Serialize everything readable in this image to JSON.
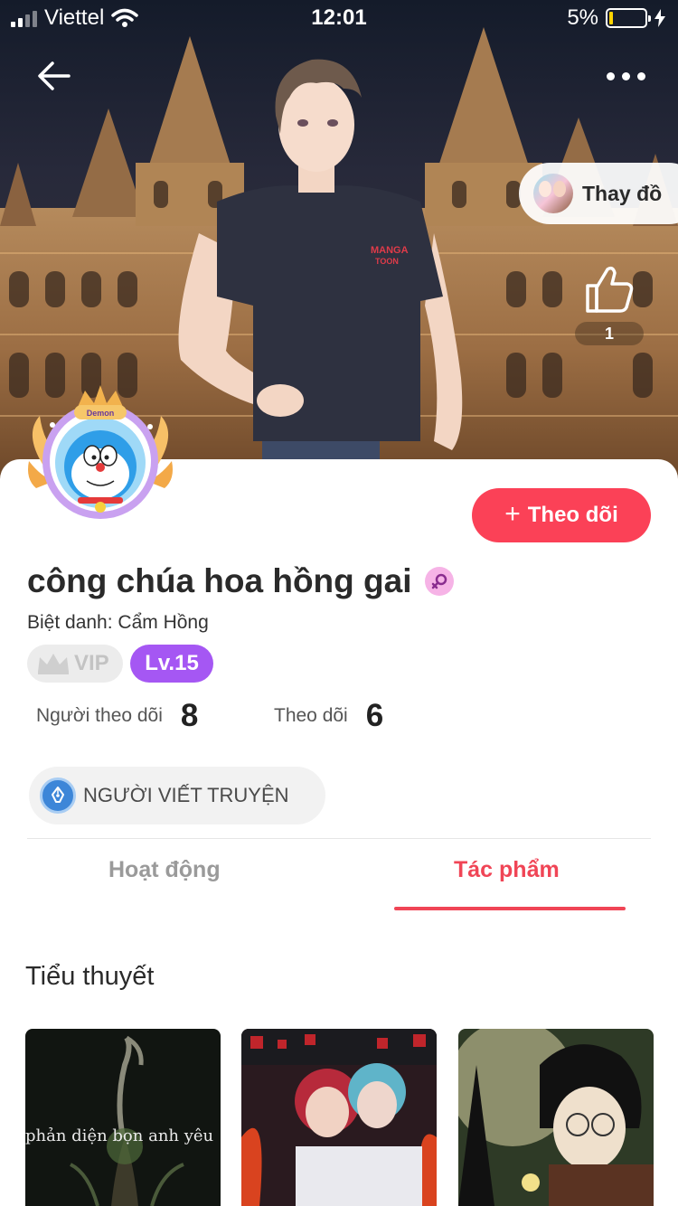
{
  "status_bar": {
    "carrier": "Viettel",
    "time": "12:01",
    "battery_percent": "5%",
    "battery_level": 0.05
  },
  "header": {
    "change_outfit_label": "Thay đồ",
    "like_count": "1"
  },
  "profile": {
    "follow_button_label": "Theo dõi",
    "username": "công chúa hoa hồng gai",
    "nickname": "Biệt danh: Cẩm Hồng",
    "vip_label": "VIP",
    "level_label": "Lv.15",
    "followers_label": "Người theo dõi",
    "followers_count": "8",
    "following_label": "Theo dõi",
    "following_count": "6",
    "role_badge": "NGƯỜI VIẾT TRUYỆN",
    "avatar_frame_text": "Demon"
  },
  "tabs": [
    {
      "label": "Hoạt động",
      "active": false
    },
    {
      "label": "Tác phẩm",
      "active": true
    }
  ],
  "works": {
    "section_title": "Tiểu thuyết",
    "books": [
      {
        "caption": "phản diện bọn anh yêu"
      },
      {
        "caption": ""
      },
      {
        "caption": ""
      }
    ]
  },
  "colors": {
    "accent": "#fb4157",
    "level_badge": "#a557f3",
    "gender_badge": "#f6b3e6",
    "tab_active": "#f04556"
  },
  "icons": [
    "back-arrow-icon",
    "more-icon",
    "thumbs-up-icon",
    "plus-icon",
    "female-icon",
    "crown-icon",
    "pen-nib-icon",
    "wifi-icon",
    "charging-icon"
  ]
}
